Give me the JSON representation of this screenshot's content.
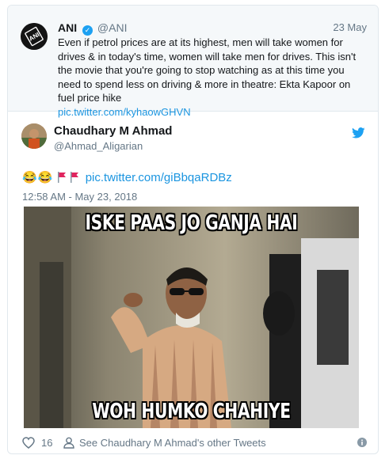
{
  "quoted_tweet": {
    "name": "ANI",
    "handle": "@ANI",
    "date": "23 May",
    "text": "Even if petrol prices are at its highest, men will take women for drives & in today's time, women will take men for drives. This isn't the movie that you're going to stop watching as at this time you need to spend less on driving & more in theatre: Ekta Kapoor on fuel price hike",
    "link": "pic.twitter.com/kyhaowGHVN",
    "avatar_text": "ANI",
    "verified_icon": "verified-check-icon"
  },
  "main_tweet": {
    "name": "Chaudhary M Ahmad",
    "handle": "@Ahmad_Aligarian",
    "emoji_1": "😂",
    "emoji_2": "😂",
    "link": "pic.twitter.com/giBbqaRDBz",
    "timestamp": "12:58 AM - May 23, 2018",
    "meme_top_text": "ISKE PAAS JO GANJA HAI",
    "meme_bottom_text": "WOH HUMKO CHAHIYE"
  },
  "footer": {
    "like_count": "16",
    "other_tweets_label": "See Chaudhary M Ahmad's other Tweets"
  },
  "colors": {
    "twitter_blue": "#1da1f2",
    "link_blue": "#1b95e0",
    "muted_gray": "#657786",
    "flag_red": "#e0245e"
  }
}
